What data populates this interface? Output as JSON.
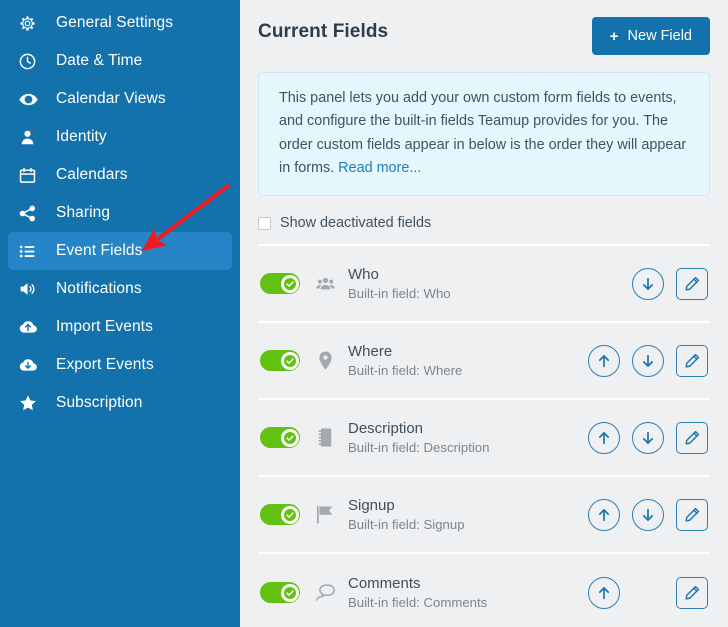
{
  "sidebar": {
    "bg_color": "#1372ac",
    "active_color": "#2585c6",
    "items": [
      {
        "label": "General Settings",
        "icon": "gear-icon",
        "active": false
      },
      {
        "label": "Date & Time",
        "icon": "clock-icon",
        "active": false
      },
      {
        "label": "Calendar Views",
        "icon": "eye-icon",
        "active": false
      },
      {
        "label": "Identity",
        "icon": "person-icon",
        "active": false
      },
      {
        "label": "Calendars",
        "icon": "calendar-icon",
        "active": false
      },
      {
        "label": "Sharing",
        "icon": "share-icon",
        "active": false
      },
      {
        "label": "Event Fields",
        "icon": "list-icon",
        "active": true
      },
      {
        "label": "Notifications",
        "icon": "speaker-icon",
        "active": false
      },
      {
        "label": "Import Events",
        "icon": "cloud-upload-icon",
        "active": false
      },
      {
        "label": "Export Events",
        "icon": "cloud-download-icon",
        "active": false
      },
      {
        "label": "Subscription",
        "icon": "star-icon",
        "active": false
      }
    ],
    "annotation": {
      "type": "arrow",
      "color": "#ec1c24",
      "points_to": "Event Fields"
    }
  },
  "header": {
    "title": "Current Fields",
    "new_field_button": {
      "label": "New Field",
      "plus": "+",
      "color": "#1372ac"
    }
  },
  "info_box": {
    "bg_color": "#e5f6fd",
    "text_part1": "This panel lets you add your own custom form fields to events, and configure the built-in fields Teamup provides for you. The order custom fields appear in below is the order they will appear in forms. ",
    "link_text": "Read more...",
    "link_color": "#1e7fb8"
  },
  "show_deactivated": {
    "label": "Show deactivated fields",
    "checked": false
  },
  "fields": {
    "toggle_on_color": "#63c112",
    "action_color": "#1a74ac",
    "rows": [
      {
        "name": "Who",
        "sub": "Built-in field: Who",
        "icon": "people-icon",
        "enabled": true,
        "has_up": false,
        "has_down": true,
        "has_edit": true
      },
      {
        "name": "Where",
        "sub": "Built-in field: Where",
        "icon": "map-pin-icon",
        "enabled": true,
        "has_up": true,
        "has_down": true,
        "has_edit": true
      },
      {
        "name": "Description",
        "sub": "Built-in field: Description",
        "icon": "notebook-icon",
        "enabled": true,
        "has_up": true,
        "has_down": true,
        "has_edit": true
      },
      {
        "name": "Signup",
        "sub": "Built-in field: Signup",
        "icon": "flag-icon",
        "enabled": true,
        "has_up": true,
        "has_down": true,
        "has_edit": true
      },
      {
        "name": "Comments",
        "sub": "Built-in field: Comments",
        "icon": "comment-icon",
        "enabled": true,
        "has_up": true,
        "has_down": false,
        "has_edit": true
      }
    ]
  }
}
